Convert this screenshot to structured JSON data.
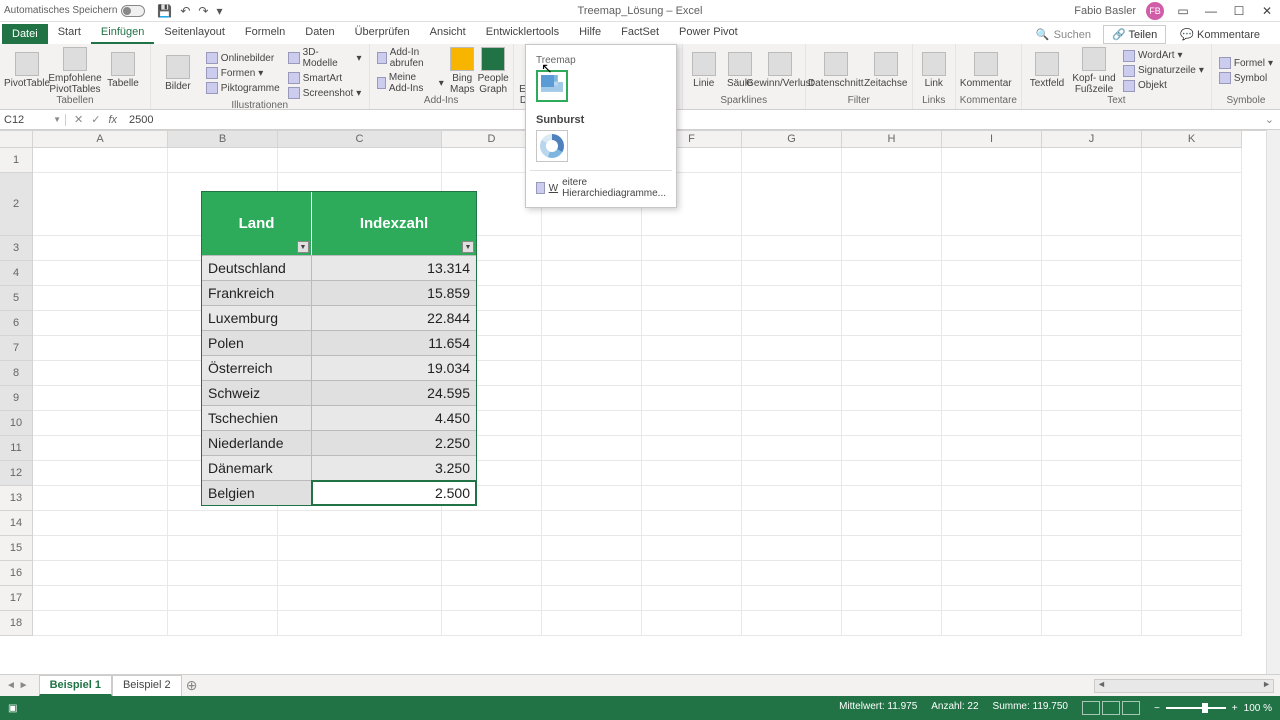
{
  "title": {
    "autosave": "Automatisches Speichern",
    "doc": "Treemap_Lösung",
    "app": "Excel",
    "user": "Fabio Basler",
    "initials": "FB"
  },
  "tabs": {
    "file": "Datei",
    "items": [
      "Start",
      "Einfügen",
      "Seitenlayout",
      "Formeln",
      "Daten",
      "Überprüfen",
      "Ansicht",
      "Entwicklertools",
      "Hilfe",
      "FactSet",
      "Power Pivot"
    ],
    "active": 1,
    "search": "Suchen",
    "share": "Teilen",
    "comments": "Kommentare"
  },
  "ribbon": {
    "groups": {
      "tabellen": {
        "label": "Tabellen",
        "pivot": "PivotTable",
        "recommended": "Empfohlene PivotTables",
        "table": "Tabelle"
      },
      "illus": {
        "label": "Illustrationen",
        "bilder": "Bilder",
        "online": "Onlinebilder",
        "formen": "Formen",
        "smartart": "SmartArt",
        "d3": "3D-Modelle",
        "pikto": "Piktogramme",
        "screenshot": "Screenshot"
      },
      "addins": {
        "label": "Add-Ins",
        "get": "Add-In abrufen",
        "mine": "Meine Add-Ins",
        "bing": "Bing Maps",
        "people": "People Graph"
      },
      "charts": {
        "recommended": "Empfohlene Diagramme"
      },
      "spark": {
        "label": "Sparklines",
        "line": "Linie",
        "col": "Säule",
        "winloss": "Gewinn/Verlust"
      },
      "filter": {
        "label": "Filter",
        "slicer": "Datenschnitt",
        "timeline": "Zeitachse"
      },
      "links": {
        "label": "Links",
        "link": "Link"
      },
      "comments": {
        "label": "Kommentare",
        "comment": "Kommentar"
      },
      "text": {
        "label": "Text",
        "textfeld": "Textfeld",
        "header": "Kopf- und Fußzeile",
        "wordart": "WordArt",
        "sig": "Signaturzeile",
        "obj": "Objekt"
      },
      "symbols": {
        "label": "Symbole",
        "formula": "Formel",
        "symbol": "Symbol"
      }
    }
  },
  "dropdown": {
    "treemap": "Treemap",
    "sunburst": "Sunburst",
    "more": "Weitere Hierarchiediagramme...",
    "more_short": "W"
  },
  "namebox": "C12",
  "formula": "2500",
  "columns": [
    "A",
    "B",
    "C",
    "D",
    "E",
    "F",
    "G",
    "H",
    "I",
    "J",
    "K"
  ],
  "rows_count": 18,
  "colwidths": {
    "A": 135,
    "B": 110,
    "C": 164,
    "rest": 100
  },
  "table": {
    "header": {
      "land": "Land",
      "index": "Indexzahl"
    },
    "rows": [
      {
        "land": "Deutschland",
        "index": "13.314"
      },
      {
        "land": "Frankreich",
        "index": "15.859"
      },
      {
        "land": "Luxemburg",
        "index": "22.844"
      },
      {
        "land": "Polen",
        "index": "11.654"
      },
      {
        "land": "Österreich",
        "index": "19.034"
      },
      {
        "land": "Schweiz",
        "index": "24.595"
      },
      {
        "land": "Tschechien",
        "index": "4.450"
      },
      {
        "land": "Niederlande",
        "index": "2.250"
      },
      {
        "land": "Dänemark",
        "index": "3.250"
      },
      {
        "land": "Belgien",
        "index": "2.500"
      }
    ]
  },
  "sheets": {
    "items": [
      "Beispiel 1",
      "Beispiel 2"
    ],
    "active": 0
  },
  "status": {
    "mean": {
      "label": "Mittelwert:",
      "val": "11.975"
    },
    "count": {
      "label": "Anzahl:",
      "val": "22"
    },
    "sum": {
      "label": "Summe:",
      "val": "119.750"
    },
    "zoom": "100 %"
  }
}
